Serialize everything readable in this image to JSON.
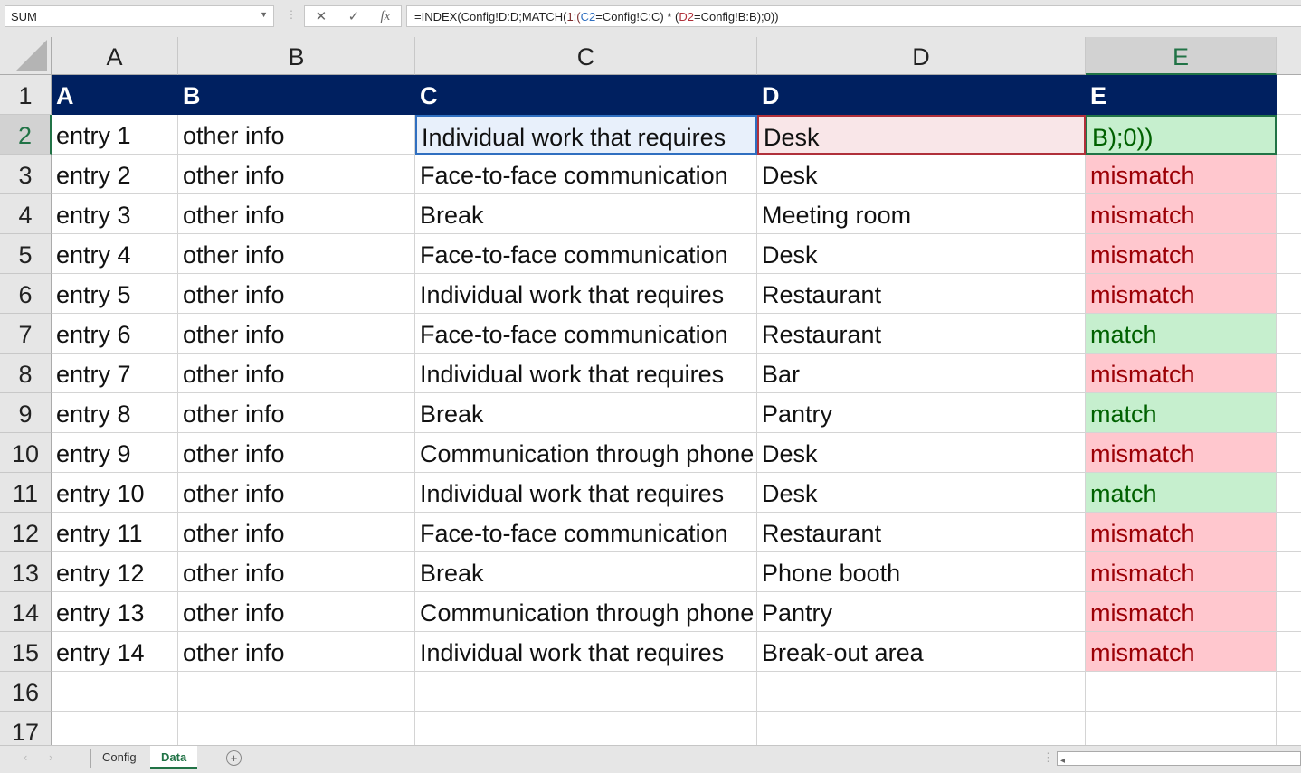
{
  "name_box": "SUM",
  "formula": [
    {
      "t": "=INDEX(Config!D:D;MATCH(",
      "c": "#222"
    },
    {
      "t": "1;(",
      "c": "#7a2a2a"
    },
    {
      "t": "C2",
      "c": "#2f6fc0"
    },
    {
      "t": "=Config!C:C) * (",
      "c": "#222"
    },
    {
      "t": "D2",
      "c": "#b0303a"
    },
    {
      "t": "=Config!B:B);0))",
      "c": "#222"
    }
  ],
  "columns": [
    "A",
    "B",
    "C",
    "D",
    "E"
  ],
  "header_row": [
    "A",
    "B",
    "C",
    "D",
    "E"
  ],
  "rows": [
    [
      "entry 1",
      "other info",
      "Individual work that requires",
      "Desk",
      "B);0))",
      "edit"
    ],
    [
      "entry 2",
      "other info",
      "Face-to-face communication",
      "Desk",
      "mismatch",
      "mis"
    ],
    [
      "entry 3",
      "other info",
      "Break",
      "Meeting room",
      "mismatch",
      "mis"
    ],
    [
      "entry 4",
      "other info",
      "Face-to-face communication",
      "Desk",
      "mismatch",
      "mis"
    ],
    [
      "entry 5",
      "other info",
      "Individual work that requires",
      "Restaurant",
      "mismatch",
      "mis"
    ],
    [
      "entry 6",
      "other info",
      "Face-to-face communication",
      "Restaurant",
      "match",
      "mat"
    ],
    [
      "entry 7",
      "other info",
      "Individual work that requires",
      "Bar",
      "mismatch",
      "mis"
    ],
    [
      "entry 8",
      "other info",
      "Break",
      "Pantry",
      "match",
      "mat"
    ],
    [
      "entry 9",
      "other info",
      "Communication through phone",
      "Desk",
      "mismatch",
      "mis"
    ],
    [
      "entry 10",
      "other info",
      "Individual work that requires",
      "Desk",
      "match",
      "mat"
    ],
    [
      "entry 11",
      "other info",
      "Face-to-face communication",
      "Restaurant",
      "mismatch",
      "mis"
    ],
    [
      "entry 12",
      "other info",
      "Break",
      "Phone booth",
      "mismatch",
      "mis"
    ],
    [
      "entry 13",
      "other info",
      "Communication through phone",
      "Pantry",
      "mismatch",
      "mis"
    ],
    [
      "entry 14",
      "other info",
      "Individual work that requires",
      "Break-out area",
      "mismatch",
      "mis"
    ]
  ],
  "row_numbers": [
    "1",
    "2",
    "3",
    "4",
    "5",
    "6",
    "7",
    "8",
    "9",
    "10",
    "11",
    "12",
    "13",
    "14",
    "15",
    "16",
    "17"
  ],
  "sheet_tabs": [
    "Config",
    "Data"
  ],
  "active_sheet": "Data"
}
